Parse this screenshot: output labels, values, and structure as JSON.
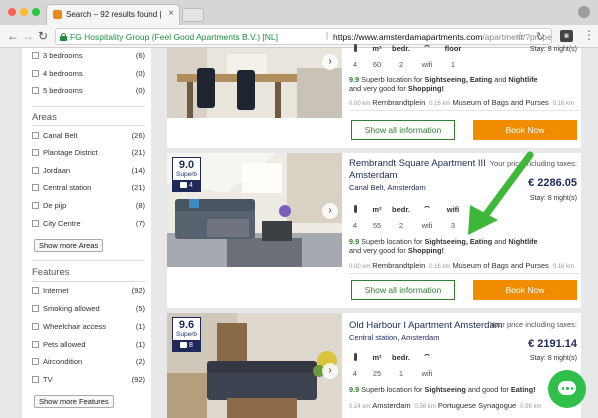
{
  "browser": {
    "tab_title": "Search – 92 results found | Se",
    "site_identity": "FG Hospitality Group (Feel Good Apartments B.V.) [NL]",
    "url_host": "https://www.amsterdamapartments.com",
    "url_path": "/apartment/?propert…"
  },
  "sidebar": {
    "bedrooms": [
      {
        "label": "3 bedrooms",
        "count": "(6)"
      },
      {
        "label": "4 bedrooms",
        "count": "(0)"
      },
      {
        "label": "5 bedrooms",
        "count": "(0)"
      }
    ],
    "areas_title": "Areas",
    "areas": [
      {
        "label": "Canal Belt",
        "count": "(26)"
      },
      {
        "label": "Plantage District",
        "count": "(21)"
      },
      {
        "label": "Jordaan",
        "count": "(14)"
      },
      {
        "label": "Central station",
        "count": "(21)"
      },
      {
        "label": "De pijp",
        "count": "(8)"
      },
      {
        "label": "City Centre",
        "count": "(7)"
      }
    ],
    "show_more_areas": "Show more Areas",
    "features_title": "Features",
    "features": [
      {
        "label": "Internet",
        "count": "(92)"
      },
      {
        "label": "Smoking allowed",
        "count": "(5)"
      },
      {
        "label": "Wheelchair access",
        "count": "(1)"
      },
      {
        "label": "Pets allowed",
        "count": "(1)"
      },
      {
        "label": "Aircondition",
        "count": "(2)"
      },
      {
        "label": "TV",
        "count": "(92)"
      }
    ],
    "show_more_features": "Show more Features"
  },
  "listings": [
    {
      "stay": "Stay: 8 night(s)",
      "features": {
        "headers": [
          "m²",
          "bedr.",
          "floor"
        ],
        "values": [
          "4",
          "60",
          "2",
          "wifi",
          "1"
        ]
      },
      "rating_text": "9.9",
      "desc_a": " Superb location for ",
      "desc_b": "Sightseeing, Eating",
      "desc_c": " and ",
      "desc_d": "Nightlife",
      "desc_e": " and very good for ",
      "desc_f": "Shopping!",
      "distances": [
        {
          "km": "0.00 km",
          "name": "Rembrandtplein"
        },
        {
          "km": "0.16 km",
          "name": "Museum of Bags and Purses"
        },
        {
          "km": "0.16 km",
          "name": ""
        }
      ],
      "show_info": "Show all information",
      "book": "Book Now"
    },
    {
      "score": "9.0",
      "score_word": "Superb",
      "reviews": "4",
      "title": "Rembrandt Square Apartment III Amsterdam",
      "location": "Canal Belt, Amsterdam",
      "price_label": "Your price including taxes:",
      "price": "€ 2286.05",
      "stay": "Stay: 8 night(s)",
      "features": {
        "headers": [
          "m²",
          "bedr.",
          "wifi"
        ],
        "values": [
          "4",
          "55",
          "2",
          "wifi",
          "3"
        ]
      },
      "rating_text": "9.9",
      "desc_a": " Superb location for ",
      "desc_b": "Sightseeing, Eating",
      "desc_c": " and ",
      "desc_d": "Nightlife",
      "desc_e": " and very good for ",
      "desc_f": "Shopping!",
      "distances": [
        {
          "km": "0.00 km",
          "name": "Rembrandtplein"
        },
        {
          "km": "0.16 km",
          "name": "Museum of Bags and Purses"
        },
        {
          "km": "0.16 km",
          "name": ""
        }
      ],
      "show_info": "Show all information",
      "book": "Book Now"
    },
    {
      "score": "9.6",
      "score_word": "Superb",
      "reviews": "8",
      "title": "Old Harbour I Apartment Amsterdam",
      "location": "Central station, Amsterdam",
      "price_label": "Your price including taxes:",
      "price": "€ 2191.14",
      "stay": "Stay: 8 night(s)",
      "features": {
        "headers": [
          "m²",
          "bedr.",
          "wifi"
        ],
        "values": [
          "4",
          "25",
          "1",
          "wifi",
          ""
        ]
      },
      "rating_text": "9.9",
      "desc_a": " Superb location for ",
      "desc_b": "Sightseeing",
      "desc_c": " and good for ",
      "desc_d": "Eating!",
      "desc_e": "",
      "desc_f": "",
      "distances": [
        {
          "km": "0.24 km",
          "name": "Amsterdam"
        },
        {
          "km": "0.56 km",
          "name": "Portuguese Synagogue"
        },
        {
          "km": "0.56 km",
          "name": ""
        }
      ]
    }
  ],
  "colors": {
    "brand_navy": "#1f2a5b",
    "book_orange": "#ef8c00",
    "info_green": "#2e7d32",
    "annotation_arrow": "#3db83a",
    "chat_green": "#2fbf4a"
  },
  "icons": [
    "close-icon",
    "back-icon",
    "forward-icon",
    "reload-icon",
    "lock-icon",
    "star-icon",
    "extension-icon",
    "menu-icon",
    "arrow-right-icon",
    "person-icon",
    "wifi-icon",
    "chat-icon"
  ]
}
